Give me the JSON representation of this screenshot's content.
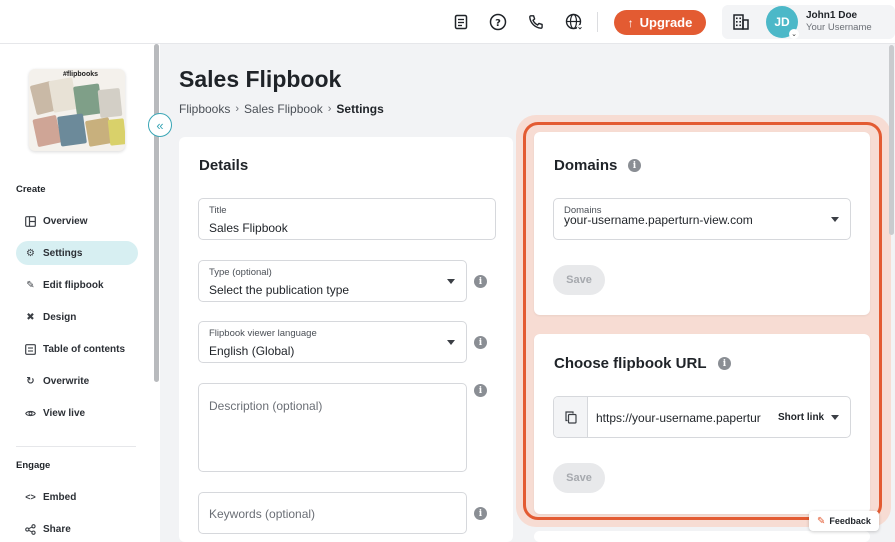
{
  "topbar": {
    "icons": [
      "document-icon",
      "help-icon",
      "phone-icon",
      "globe-icon",
      "building-icon"
    ],
    "upgrade_label": "Upgrade",
    "user": {
      "initials": "JD",
      "name": "John1 Doe",
      "username": "Your Username"
    }
  },
  "sidebar": {
    "sections": [
      {
        "label": "Create"
      },
      {
        "label": "Engage"
      }
    ],
    "create_items": [
      {
        "label": "Overview",
        "icon": "layout-icon"
      },
      {
        "label": "Settings",
        "icon": "gear-icon",
        "active": true
      },
      {
        "label": "Edit flipbook",
        "icon": "pencil-icon"
      },
      {
        "label": "Design",
        "icon": "design-icon"
      },
      {
        "label": "Table of contents",
        "icon": "list-icon"
      },
      {
        "label": "Overwrite",
        "icon": "refresh-icon"
      },
      {
        "label": "View live",
        "icon": "eye-icon"
      }
    ],
    "engage_items": [
      {
        "label": "Embed",
        "icon": "code-icon"
      },
      {
        "label": "Share",
        "icon": "share-icon"
      }
    ],
    "thumbnail_text": "#flipbooks"
  },
  "page": {
    "title": "Sales Flipbook",
    "breadcrumb": [
      "Flipbooks",
      "Sales Flipbook",
      "Settings"
    ]
  },
  "details": {
    "title": "Details",
    "title_field": {
      "label": "Title",
      "value": "Sales Flipbook"
    },
    "type_field": {
      "label": "Type (optional)",
      "value": "Select the publication type"
    },
    "language_field": {
      "label": "Flipbook viewer language",
      "value": "English (Global)"
    },
    "description_placeholder": "Description (optional)",
    "keywords_placeholder": "Keywords (optional)"
  },
  "domains": {
    "title": "Domains",
    "field_label": "Domains",
    "value": "your-username.paperturn-view.com",
    "save_label": "Save"
  },
  "flipbook_url": {
    "title": "Choose flipbook URL",
    "url": "https://your-username.papertur",
    "link_type": "Short link",
    "save_label": "Save"
  },
  "feedback_label": "Feedback",
  "colors": {
    "accent": "#e35b32",
    "teal": "#4cb8c8",
    "active_bg": "#d7eff2"
  }
}
